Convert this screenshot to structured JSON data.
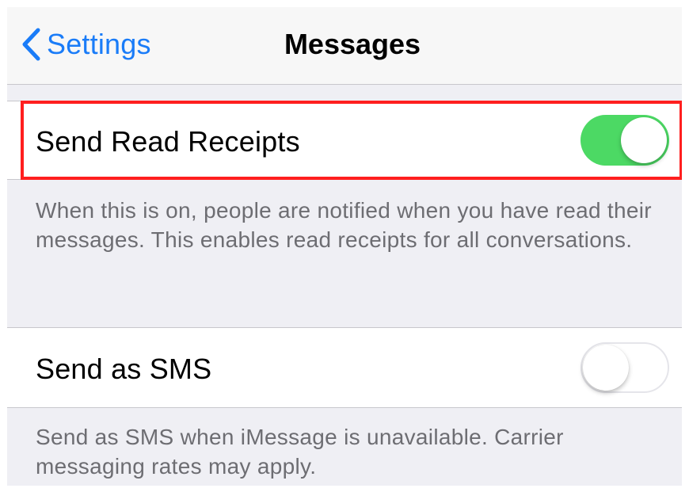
{
  "navbar": {
    "back_label": "Settings",
    "title": "Messages",
    "back_icon": "chevron-left-icon"
  },
  "settings": [
    {
      "label": "Send Read Receipts",
      "toggle_on": true,
      "footnote": "When this is on, people are notified when you have read their messages. This enables read receipts for all conversations."
    },
    {
      "label": "Send as SMS",
      "toggle_on": false,
      "footnote": "Send as SMS when iMessage is unavailable. Carrier messaging rates may apply."
    }
  ],
  "colors": {
    "accent": "#1a7cf8",
    "toggle_on": "#4cd964",
    "highlight": "#ff1f1f",
    "footnote": "#6d6d72",
    "background": "#efeff4"
  }
}
